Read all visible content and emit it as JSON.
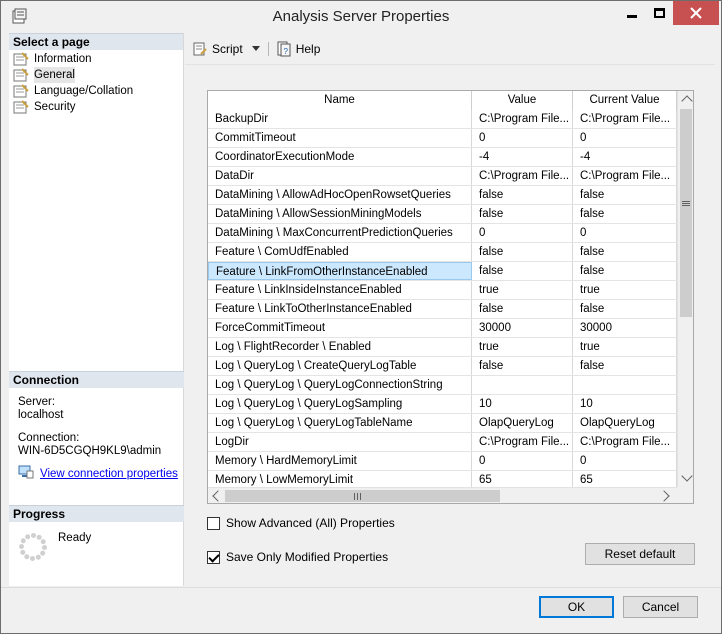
{
  "window": {
    "title": "Analysis Server Properties",
    "accent_close": "#c75050"
  },
  "left": {
    "select_page_label": "Select a page",
    "pages": [
      {
        "label": "Information",
        "icon": "wrench-page-icon"
      },
      {
        "label": "General",
        "icon": "wrench-page-icon",
        "selected": true
      },
      {
        "label": "Language/Collation",
        "icon": "wrench-page-icon"
      },
      {
        "label": "Security",
        "icon": "wrench-page-icon"
      }
    ],
    "connection_label": "Connection",
    "server_label": "Server:",
    "server_value": "localhost",
    "connection_field_label": "Connection:",
    "connection_value": "WIN-6D5CGQH9KL9\\admin",
    "view_connection_link": "View connection properties",
    "progress_label": "Progress",
    "progress_status": "Ready"
  },
  "toolbar": {
    "script_label": "Script",
    "help_label": "Help"
  },
  "grid": {
    "headers": {
      "name": "Name",
      "value": "Value",
      "current": "Current Value"
    },
    "rows": [
      {
        "name": "BackupDir",
        "value": "C:\\Program File...",
        "current": "C:\\Program File..."
      },
      {
        "name": "CommitTimeout",
        "value": "0",
        "current": "0"
      },
      {
        "name": "CoordinatorExecutionMode",
        "value": "-4",
        "current": "-4"
      },
      {
        "name": "DataDir",
        "value": "C:\\Program File...",
        "current": "C:\\Program File..."
      },
      {
        "name": "DataMining \\ AllowAdHocOpenRowsetQueries",
        "value": "false",
        "current": "false"
      },
      {
        "name": "DataMining \\ AllowSessionMiningModels",
        "value": "false",
        "current": "false"
      },
      {
        "name": "DataMining \\ MaxConcurrentPredictionQueries",
        "value": "0",
        "current": "0"
      },
      {
        "name": "Feature \\ ComUdfEnabled",
        "value": "false",
        "current": "false"
      },
      {
        "name": "Feature \\ LinkFromOtherInstanceEnabled",
        "value": "false",
        "current": "false",
        "selected": true
      },
      {
        "name": "Feature \\ LinkInsideInstanceEnabled",
        "value": "true",
        "current": "true"
      },
      {
        "name": "Feature \\ LinkToOtherInstanceEnabled",
        "value": "false",
        "current": "false"
      },
      {
        "name": "ForceCommitTimeout",
        "value": "30000",
        "current": "30000"
      },
      {
        "name": "Log \\ FlightRecorder \\ Enabled",
        "value": "true",
        "current": "true"
      },
      {
        "name": "Log \\ QueryLog \\ CreateQueryLogTable",
        "value": "false",
        "current": "false"
      },
      {
        "name": "Log \\ QueryLog \\ QueryLogConnectionString",
        "value": "",
        "current": ""
      },
      {
        "name": "Log \\ QueryLog \\ QueryLogSampling",
        "value": "10",
        "current": "10"
      },
      {
        "name": "Log \\ QueryLog \\ QueryLogTableName",
        "value": "OlapQueryLog",
        "current": "OlapQueryLog"
      },
      {
        "name": "LogDir",
        "value": "C:\\Program File...",
        "current": "C:\\Program File..."
      },
      {
        "name": "Memory \\ HardMemoryLimit",
        "value": "0",
        "current": "0"
      },
      {
        "name": "Memory \\ LowMemoryLimit",
        "value": "65",
        "current": "65"
      }
    ]
  },
  "options": {
    "show_advanced_label": "Show Advanced (All) Properties",
    "show_advanced_checked": false,
    "save_modified_label": "Save Only Modified Properties",
    "save_modified_checked": true,
    "reset_default_label": "Reset default"
  },
  "footer": {
    "ok_label": "OK",
    "cancel_label": "Cancel"
  }
}
